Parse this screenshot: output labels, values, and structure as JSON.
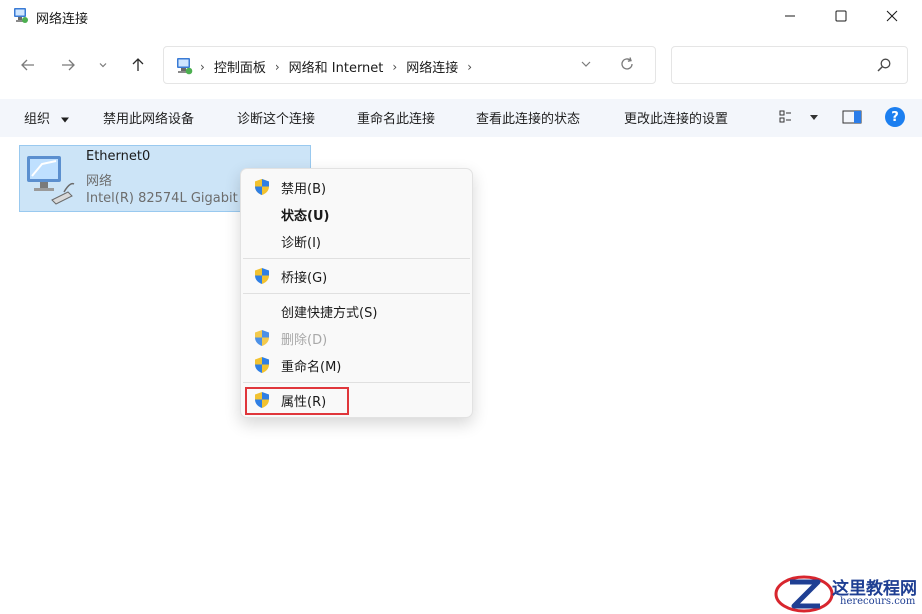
{
  "window": {
    "title": "网络连接",
    "controls": {
      "minimize": "minimize-icon",
      "maximize": "maximize-icon",
      "close": "close-icon"
    }
  },
  "address": {
    "breadcrumbs": [
      "控制面板",
      "网络和 Internet",
      "网络连接"
    ],
    "search_placeholder": ""
  },
  "commands": {
    "organize": "组织",
    "disable": "禁用此网络设备",
    "diagnose": "诊断这个连接",
    "rename": "重命名此连接",
    "status": "查看此连接的状态",
    "settings": "更改此连接的设置"
  },
  "connection": {
    "name": "Ethernet0",
    "type": "网络",
    "adapter": "Intel(R) 82574L Gigabit"
  },
  "context_menu": {
    "items": [
      {
        "label": "禁用(B)",
        "shield": true
      },
      {
        "label": "状态(U)",
        "bold": true
      },
      {
        "label": "诊断(I)"
      },
      {
        "label": "桥接(G)",
        "shield": true
      },
      {
        "label": "创建快捷方式(S)"
      },
      {
        "label": "删除(D)",
        "shield": true,
        "disabled": true
      },
      {
        "label": "重命名(M)",
        "shield": true
      },
      {
        "label": "属性(R)",
        "shield": true,
        "highlighted": true
      }
    ]
  },
  "watermark": {
    "title": "这里教程网",
    "url": "herecours.com"
  },
  "colors": {
    "accent": "#1c7ff0",
    "selection": "#cce4f7",
    "highlight_border": "#e0363b",
    "watermark": "#1f3f93"
  }
}
